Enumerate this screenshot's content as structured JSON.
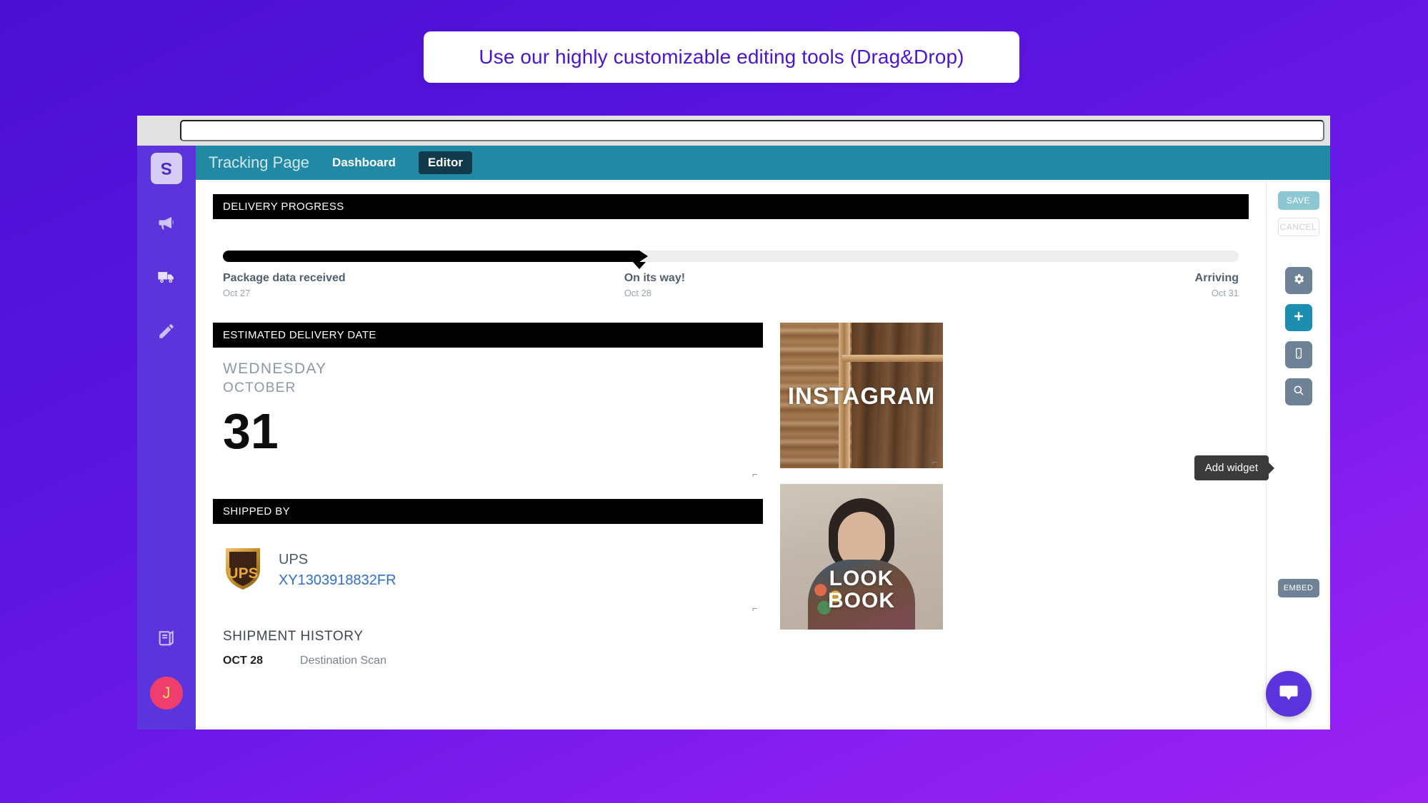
{
  "promo": {
    "text": "Use our highly customizable editing tools (Drag&Drop)",
    "accent_color": "#4b14cf"
  },
  "browser": {
    "url_value": "",
    "url_placeholder": ""
  },
  "sidebar": {
    "brand": "S",
    "items": [
      {
        "icon": "logo-s-icon",
        "label": "S"
      },
      {
        "icon": "megaphone-icon",
        "label": "Campaigns"
      },
      {
        "icon": "truck-icon",
        "label": "Shipments"
      },
      {
        "icon": "pencil-icon",
        "label": "Editor"
      },
      {
        "icon": "book-icon",
        "label": "Docs"
      }
    ],
    "avatar_initial": "J",
    "avatar_bg": "#ef3d6e"
  },
  "topnav": {
    "brand": "Tracking Page",
    "links": [
      {
        "label": "Dashboard",
        "active": false
      },
      {
        "label": "Editor",
        "active": true
      }
    ],
    "bg": "#2189a4"
  },
  "delivery_progress": {
    "header": "DELIVERY PROGRESS",
    "percent": 41,
    "steps": [
      {
        "label": "Package data received",
        "date": "Oct 27"
      },
      {
        "label": "On its way!",
        "date": "Oct 28"
      },
      {
        "label": "Arriving",
        "date": "Oct 31"
      }
    ]
  },
  "estimated_delivery": {
    "header": "ESTIMATED DELIVERY DATE",
    "weekday": "WEDNESDAY",
    "month": "OCTOBER",
    "day": "31"
  },
  "shipped_by": {
    "header": "SHIPPED BY",
    "carrier_logo": "ups-shield-icon",
    "carrier": "UPS",
    "tracking_number": "XY1303918832FR",
    "tracking_color": "#2f6fd0"
  },
  "shipment_history": {
    "title": "SHIPMENT HISTORY",
    "rows": [
      {
        "date": "OCT 28",
        "description": "Destination Scan"
      }
    ]
  },
  "widgets": [
    {
      "name": "instagram-widget",
      "caption": "INSTAGRAM"
    },
    {
      "name": "lookbook-widget",
      "caption_line1": "LOOK",
      "caption_line2": "BOOK"
    }
  ],
  "right_rail": {
    "save_label": "SAVE",
    "cancel_label": "CANCEL",
    "embed_label": "EMBED",
    "tooltip": "Add widget",
    "icons": [
      {
        "name": "gear-icon",
        "accent": false
      },
      {
        "name": "plus-icon",
        "accent": true
      },
      {
        "name": "mobile-icon",
        "accent": false
      },
      {
        "name": "search-icon",
        "accent": false
      }
    ],
    "save_bg": "#8dc7d4",
    "accent_bg": "#1e8eb0"
  },
  "intercom": {
    "name": "intercom-chat-button"
  }
}
